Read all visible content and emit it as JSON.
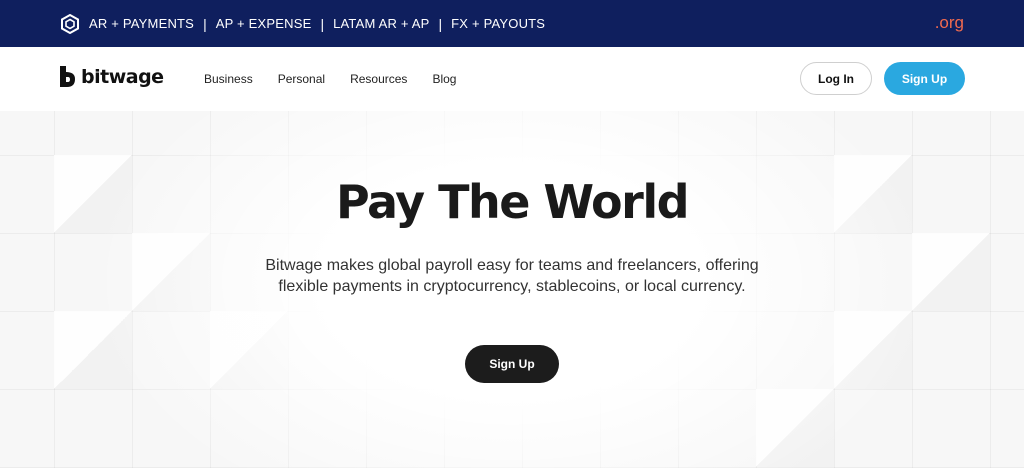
{
  "topbar": {
    "links": [
      "AR + PAYMENTS",
      "AP + EXPENSE",
      "LATAM AR + AP",
      "FX + PAYOUTS"
    ],
    "separator": "|",
    "org_label": ".org",
    "logo_icon": "hexagon-logo-icon",
    "colors": {
      "background": "#0f1f5e",
      "org": "#f06a4f"
    }
  },
  "nav": {
    "brand": "bitwage",
    "brand_icon": "bitwage-logo-icon",
    "menu": [
      "Business",
      "Personal",
      "Resources",
      "Blog"
    ],
    "login_label": "Log In",
    "signup_label": "Sign Up",
    "colors": {
      "signup": "#2aa8e0"
    }
  },
  "hero": {
    "title": "Pay The World",
    "subtitle": "Bitwage makes global payroll easy for teams and freelancers, offering flexible payments in cryptocurrency, stablecoins, or local currency.",
    "cta_label": "Sign Up",
    "colors": {
      "cta": "#1c1c1c"
    }
  }
}
